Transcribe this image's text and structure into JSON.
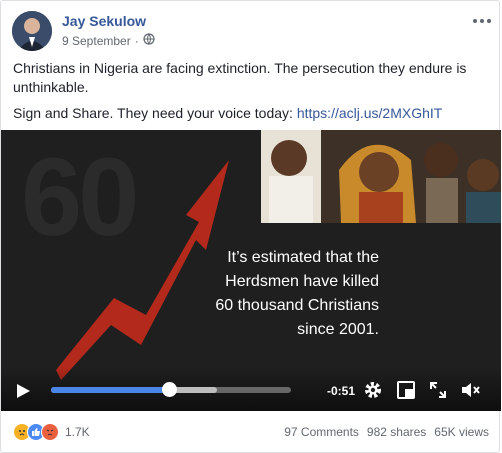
{
  "post": {
    "author": "Jay Sekulow",
    "date": "9 September",
    "date_separator": "·",
    "text_line1": "Christians in Nigeria are facing extinction. The persecution they endure is unthinkable.",
    "text_line2_prefix": "Sign and Share. They need your voice today: ",
    "link": "https://aclj.us/2MXGhIT"
  },
  "video": {
    "watermark_number": "60",
    "quote_lines": [
      "It’s estimated that the",
      "Herdsmen have killed",
      "60 thousand Christians",
      "since 2001."
    ],
    "time_remaining": "-0:51",
    "progress": 0.49,
    "buffered": 0.69
  },
  "footer": {
    "reaction_count": "1.7K",
    "comments": "97 Comments",
    "shares": "982 shares",
    "views": "65K views"
  },
  "colors": {
    "link": "#365899",
    "progress": "#4a86e8",
    "video_bg": "#1f1f20",
    "arrow": "#b3291b"
  },
  "icons": {
    "globe": "globe-icon",
    "more": "more-options-icon",
    "play": "play-icon",
    "settings": "settings-gear-icon",
    "pip": "picture-in-picture-icon",
    "fullscreen": "fullscreen-icon",
    "volume": "volume-icon",
    "reactions": [
      "sad-reaction-icon",
      "like-reaction-icon",
      "angry-reaction-icon"
    ]
  }
}
